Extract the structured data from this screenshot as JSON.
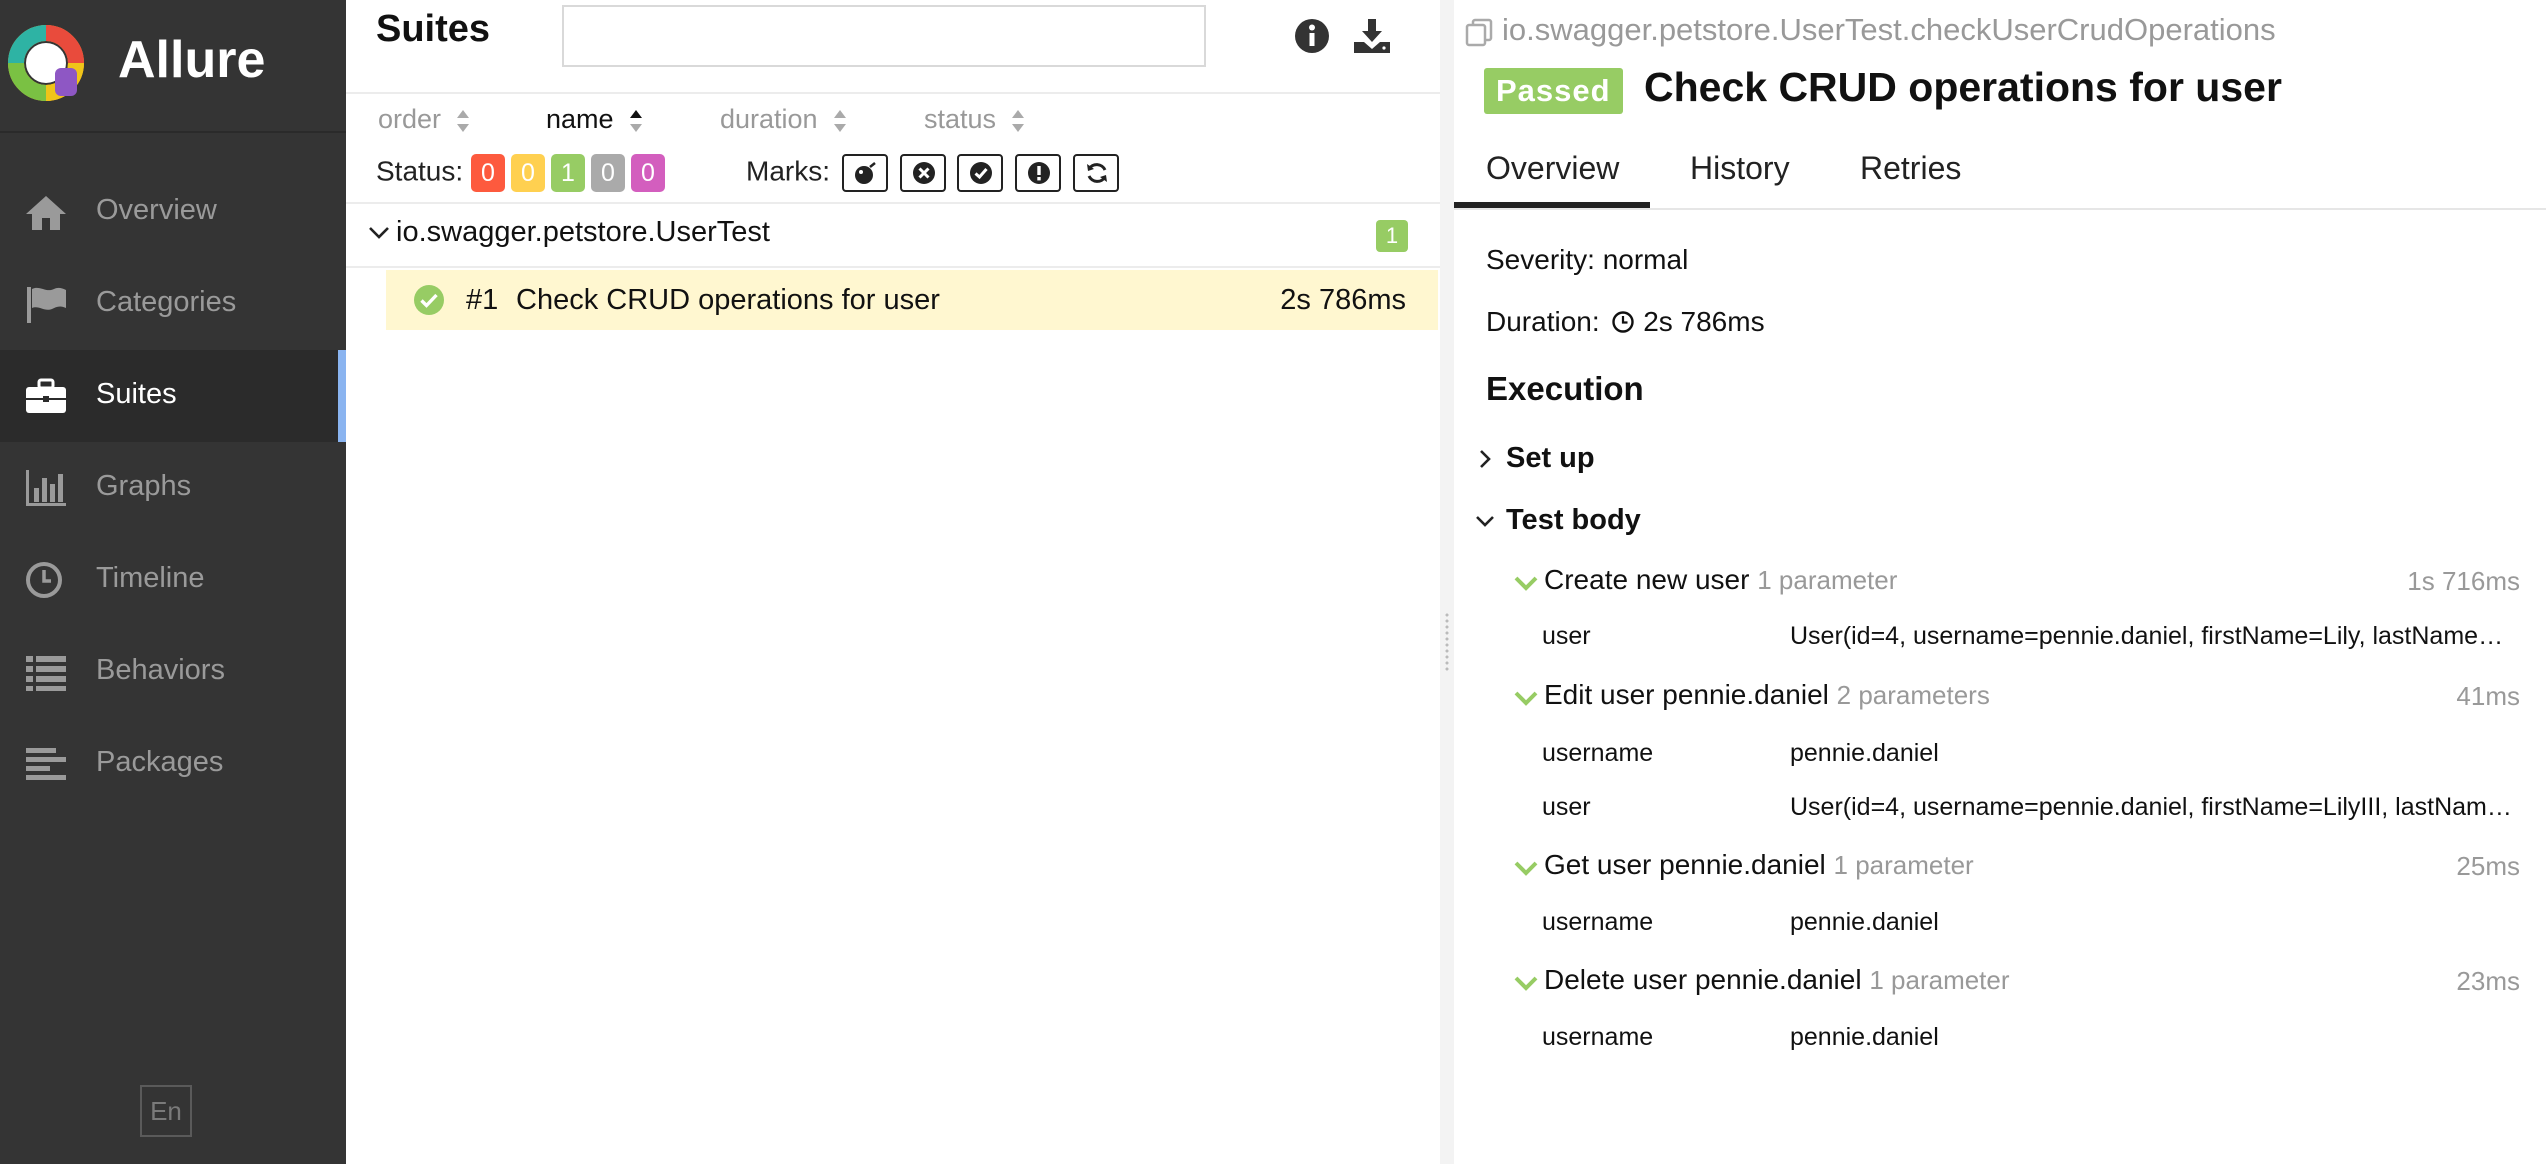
{
  "app": {
    "name": "Allure"
  },
  "sidebar": {
    "items": [
      {
        "label": "Overview",
        "icon": "home-icon"
      },
      {
        "label": "Categories",
        "icon": "flag-icon"
      },
      {
        "label": "Suites",
        "icon": "briefcase-icon",
        "active": true
      },
      {
        "label": "Graphs",
        "icon": "bar-chart-icon"
      },
      {
        "label": "Timeline",
        "icon": "clock-icon"
      },
      {
        "label": "Behaviors",
        "icon": "list-icon"
      },
      {
        "label": "Packages",
        "icon": "align-left-icon"
      }
    ],
    "language": "En",
    "accent_color": "#8ab4f0"
  },
  "suites": {
    "title": "Suites",
    "search": {
      "value": "",
      "placeholder": ""
    },
    "sort": {
      "order": "order",
      "name": "name",
      "duration": "duration",
      "status": "status"
    },
    "status_label": "Status:",
    "status_counts": [
      {
        "value": "0",
        "color": "#fd5a3e"
      },
      {
        "value": "0",
        "color": "#ffd050"
      },
      {
        "value": "1",
        "color": "#97cc64"
      },
      {
        "value": "0",
        "color": "#aaaaaa"
      },
      {
        "value": "0",
        "color": "#d35ebe"
      }
    ],
    "marks_label": "Marks:",
    "group": {
      "name": "io.swagger.petstore.UserTest",
      "count": "1"
    },
    "test": {
      "num": "#1",
      "name": "Check CRUD operations for user",
      "duration": "2s 786ms"
    }
  },
  "detail": {
    "path": "io.swagger.petstore.UserTest.checkUserCrudOperations",
    "status": "Passed",
    "status_color": "#97cc64",
    "title": "Check CRUD operations for user",
    "tabs": [
      "Overview",
      "History",
      "Retries"
    ],
    "severity": "Severity: normal",
    "duration_label": "Duration:",
    "duration_value": "2s 786ms",
    "execution_title": "Execution",
    "setup_label": "Set up",
    "body_label": "Test body",
    "steps": [
      {
        "name": "Create new user",
        "params_label": "1 parameter",
        "time": "1s 716ms",
        "params": [
          {
            "name": "user",
            "value": "User(id=4, username=pennie.daniel, firstName=Lily, lastName=M..."
          }
        ]
      },
      {
        "name": "Edit user pennie.daniel",
        "params_label": "2 parameters",
        "time": "41ms",
        "params": [
          {
            "name": "username",
            "value": "pennie.daniel"
          },
          {
            "name": "user",
            "value": "User(id=4, username=pennie.daniel, firstName=LilyIII, lastName=..."
          }
        ]
      },
      {
        "name": "Get user pennie.daniel",
        "params_label": "1 parameter",
        "time": "25ms",
        "params": [
          {
            "name": "username",
            "value": "pennie.daniel"
          }
        ]
      },
      {
        "name": "Delete user pennie.daniel",
        "params_label": "1 parameter",
        "time": "23ms",
        "params": [
          {
            "name": "username",
            "value": "pennie.daniel"
          }
        ]
      }
    ]
  }
}
